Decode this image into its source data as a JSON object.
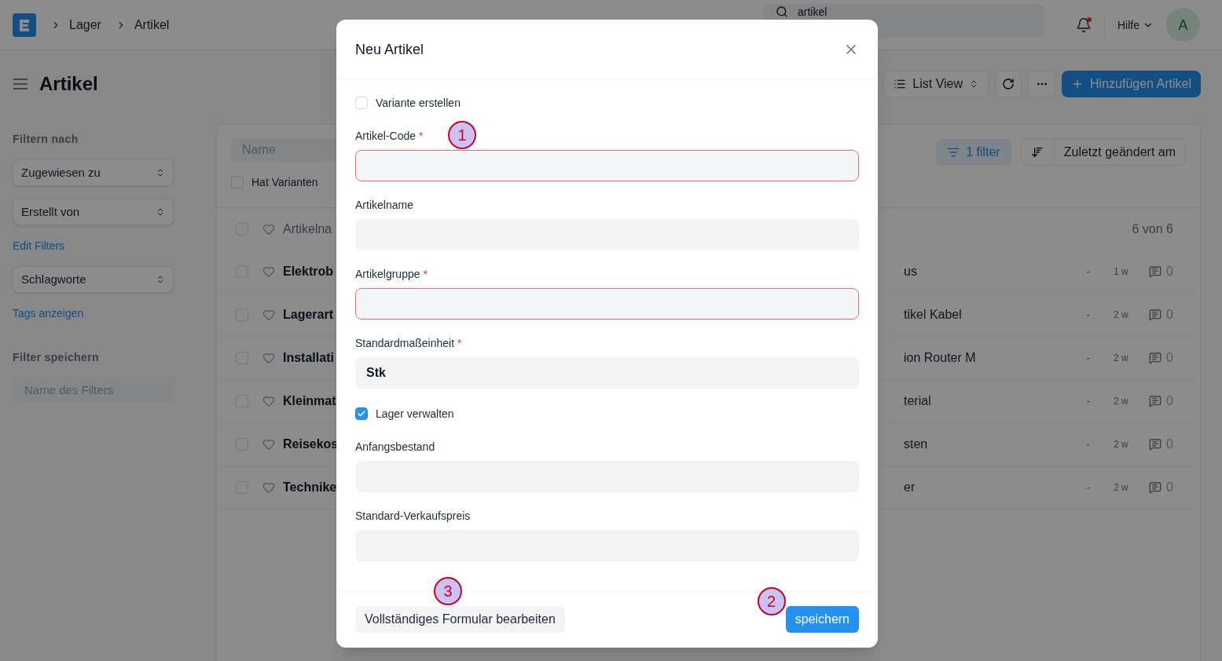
{
  "navbar": {
    "breadcrumbs": [
      "Lager",
      "Artikel"
    ],
    "search": {
      "value": "artikel"
    },
    "notifications_unread": true,
    "help": "Hilfe",
    "avatar": "A"
  },
  "page": {
    "title": "Artikel",
    "view_switcher": "List View",
    "add_button": "Hinzufügen Artikel"
  },
  "sidebar": {
    "items": [
      {
        "kind": "heading",
        "text": "Filtern nach"
      },
      {
        "kind": "select",
        "text": "Zugewiesen zu"
      },
      {
        "kind": "select",
        "text": "Erstellt von"
      },
      {
        "kind": "link",
        "text": "Edit Filters"
      },
      {
        "kind": "select",
        "text": "Schlagworte"
      },
      {
        "kind": "link",
        "text": "Tags anzeigen"
      },
      {
        "kind": "heading",
        "text": "Filter speichern"
      },
      {
        "kind": "input",
        "placeholder": "Name des Filters"
      }
    ]
  },
  "list": {
    "search": {
      "placeholder": "Name"
    },
    "variants_filter": {
      "label": "Hat Varianten",
      "checked": false
    },
    "filter_button": "1 filter",
    "sort": "Zuletzt geändert am",
    "header": {
      "name": "Artikelna",
      "count": "6 von 6",
      "checked": false
    },
    "rows": [
      {
        "name_start": "Elektrob",
        "name_end": "us",
        "column_3": "-",
        "modified": "1 w",
        "comments": "0",
        "checked": false,
        "liked": false
      },
      {
        "name_start": "Lagerart",
        "name_end": "tikel Kabel",
        "column_3": "-",
        "modified": "2 w",
        "comments": "0",
        "checked": false,
        "liked": false
      },
      {
        "name_start": "Installati",
        "name_end": "ion Router M",
        "column_3": "-",
        "modified": "2 w",
        "comments": "0",
        "checked": false,
        "liked": false
      },
      {
        "name_start": "Kleinmat",
        "name_end": "terial",
        "column_3": "-",
        "modified": "2 w",
        "comments": "0",
        "checked": false,
        "liked": false
      },
      {
        "name_start": "Reisekos",
        "name_end": "sten",
        "column_3": "-",
        "modified": "2 w",
        "comments": "0",
        "checked": false,
        "liked": false
      },
      {
        "name_start": "Technike",
        "name_end": "er",
        "column_3": "-",
        "modified": "2 w",
        "comments": "0",
        "checked": false,
        "liked": false
      }
    ]
  },
  "dialog": {
    "title": "Neu Artikel",
    "fields": [
      {
        "kind": "checkbox",
        "label": "Variante erstellen",
        "checked": false
      },
      {
        "kind": "input",
        "label": "Artikel-Code",
        "required_mark": "*",
        "invalid": true,
        "annotation": "1"
      },
      {
        "kind": "input",
        "label": "Artikelname",
        "invalid": false
      },
      {
        "kind": "input",
        "label": "Artikelgruppe",
        "required_mark": "*",
        "invalid": true
      },
      {
        "kind": "input",
        "label": "Standardmaßeinheit",
        "required_mark": "*",
        "invalid": false,
        "value": "Stk"
      },
      {
        "kind": "checkbox",
        "label": "Lager verwalten",
        "checked": true
      },
      {
        "kind": "input",
        "label": "Anfangsbestand",
        "invalid": false
      },
      {
        "kind": "input",
        "label": "Standard-Verkaufspreis",
        "invalid": false
      }
    ],
    "secondary_button": {
      "label": "Vollständiges Formular bearbeiten",
      "annotation": "3"
    },
    "primary_button": {
      "label": "speichern",
      "annotation": "2"
    }
  }
}
